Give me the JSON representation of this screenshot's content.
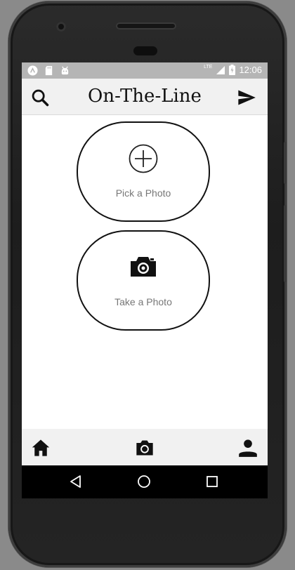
{
  "status_bar": {
    "left_icons": [
      "android-icon",
      "sd-card-icon",
      "android-bug-icon"
    ],
    "network": "LTE",
    "time": "12:06"
  },
  "app_bar": {
    "title": "On-The-Line",
    "left_icon": "search-icon",
    "right_icon": "send-icon"
  },
  "actions": [
    {
      "label": "Pick a Photo",
      "icon": "add-circle-icon"
    },
    {
      "label": "Take a Photo",
      "icon": "camera-icon"
    }
  ],
  "bottom_nav": [
    "home-icon",
    "camera-icon",
    "person-icon"
  ],
  "system_nav": [
    "back-icon",
    "home-circle-icon",
    "recents-icon"
  ],
  "colors": {
    "status_bar": "#b5b5b5",
    "app_bar": "#f1f1f1",
    "pill_border": "#111111",
    "label": "#777777",
    "system_nav": "#000000"
  }
}
